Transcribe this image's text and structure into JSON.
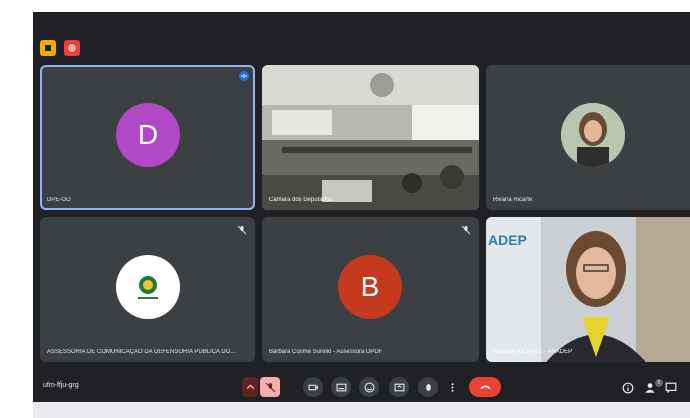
{
  "participants": [
    {
      "name": "DPE-GO",
      "initial": "D",
      "avatar_color": "#b148c5"
    },
    {
      "name": "Camara dos Deputados",
      "initial": ""
    },
    {
      "name": "Rivana Ricarte",
      "initial": ""
    },
    {
      "name": "ASSESSORIA DE COMUNICAÇÃO DA DEFENSORIA PÚBLICA DO...",
      "initial": ""
    },
    {
      "name": "Bárbara Cosme Surelio - Assessora DPDF",
      "initial": "B",
      "avatar_color": "#c5391f"
    },
    {
      "name": "RIVANA RICARTE - ANADEP",
      "initial": ""
    }
  ],
  "meeting": {
    "code": "ufm-ffju-grg",
    "participant_count": "6"
  },
  "colors": {
    "background": "#202124",
    "tile": "#3c4043",
    "end_call": "#ea4335",
    "active_speaker": "#8ab4f8"
  },
  "icons": [
    "hand-icon",
    "record-icon",
    "mic-off-icon",
    "camera-icon",
    "captions-icon",
    "emoji-icon",
    "present-icon",
    "raise-hand-icon",
    "more-icon",
    "end-call-icon",
    "info-icon",
    "people-icon",
    "chat-icon"
  ]
}
